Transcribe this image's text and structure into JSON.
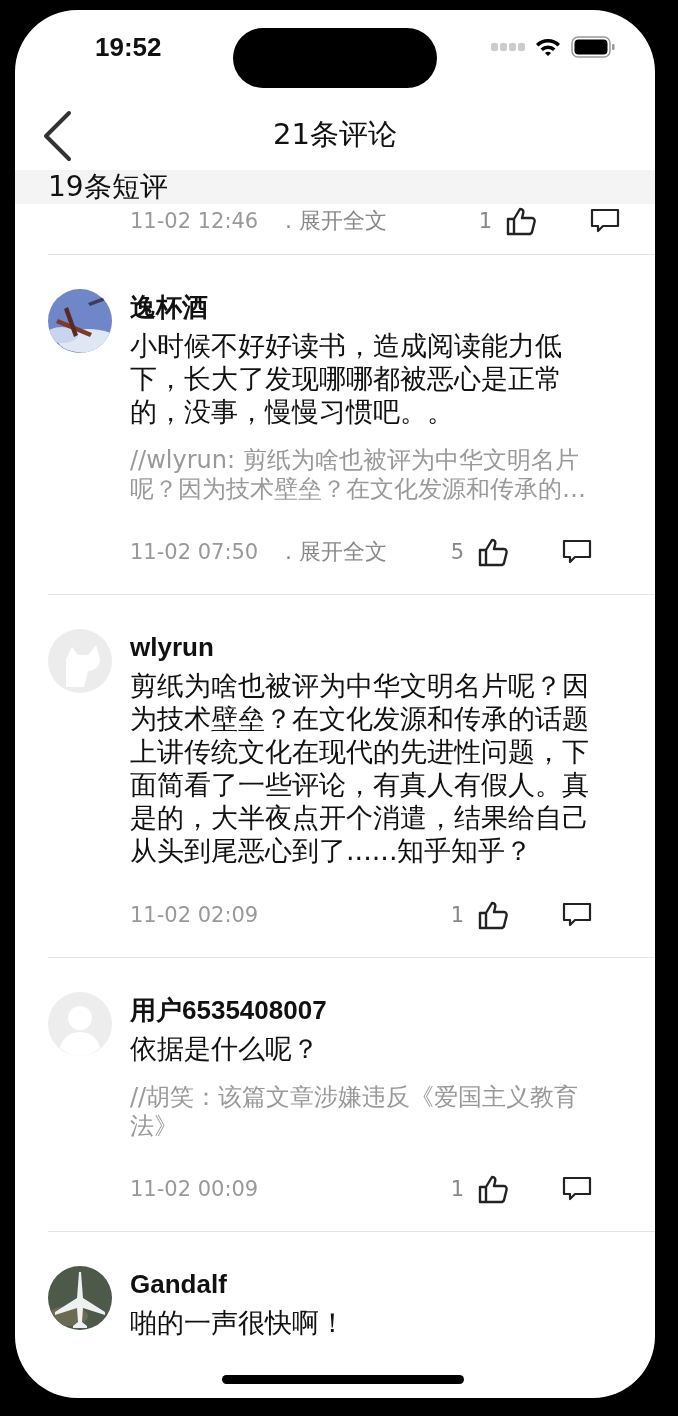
{
  "status_bar": {
    "time": "19:52"
  },
  "nav": {
    "title": "21条评论"
  },
  "section": {
    "title": "19条短评"
  },
  "partial_row": {
    "date": "11-02 12:46",
    "expand": ". 展开全文",
    "likes": "1"
  },
  "comments": [
    {
      "name": "逸杯酒",
      "body": "小时候不好好读书，造成阅读能力低下，长大了发现哪哪都被恶心是正常的，没事，慢慢习惯吧。。",
      "quote": "//wlyrun: 剪纸为啥也被评为中华文明名片呢？因为技术壁垒？在文化发源和传承的…",
      "date": "11-02 07:50",
      "expand": ". 展开全文",
      "likes": "5"
    },
    {
      "avatar": {
        "kind": "animal"
      },
      "name": "wlyrun",
      "body": "剪纸为啥也被评为中华文明名片呢？因为技术壁垒？在文化发源和传承的话题上讲传统文化在现代的先进性问题，下面简看了一些评论，有真人有假人。真是的，大半夜点开个消遣，结果给自己从头到尾恶心到了......知乎知乎？",
      "date": "11-02 02:09",
      "likes": "1"
    },
    {
      "avatar": {
        "kind": "person"
      },
      "name": "用户6535408007",
      "body": "依据是什么呢？",
      "quote": "//胡笑：该篇文章涉嫌违反《爱国主义教育法》",
      "date": "11-02 00:09",
      "likes": "1"
    },
    {
      "name": "Gandalf",
      "body": "啪的一声很快啊！"
    }
  ]
}
